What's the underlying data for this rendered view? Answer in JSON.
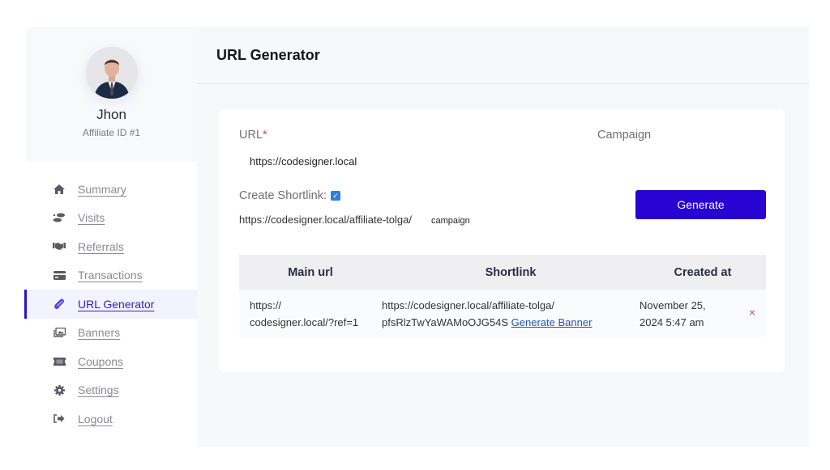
{
  "profile": {
    "name": "Jhon",
    "affiliate_id": "Affiliate ID #1",
    "avatar_icon": "user-photo"
  },
  "sidebar": {
    "items": [
      {
        "label": "Summary",
        "icon": "home-icon",
        "active": false
      },
      {
        "label": "Visits",
        "icon": "footprints-icon",
        "active": false
      },
      {
        "label": "Referrals",
        "icon": "handshake-icon",
        "active": false
      },
      {
        "label": "Transactions",
        "icon": "credit-card-icon",
        "active": false
      },
      {
        "label": "URL Generator",
        "icon": "paperclip-icon",
        "active": true
      },
      {
        "label": "Banners",
        "icon": "images-icon",
        "active": false
      },
      {
        "label": "Coupons",
        "icon": "ticket-icon",
        "active": false
      },
      {
        "label": "Settings",
        "icon": "gear-icon",
        "active": false
      },
      {
        "label": "Logout",
        "icon": "sign-out-icon",
        "active": false
      }
    ]
  },
  "header": {
    "title": "URL Generator"
  },
  "form": {
    "url_label": "URL",
    "required_mark": "*",
    "url_value": "https://codesigner.local",
    "campaign_label": "Campaign",
    "shortlink_label": "Create Shortlink:",
    "shortlink_checked": true,
    "shortlink_base": "https://codesigner.local/affiliate-tolga/",
    "shortlink_campaign": "campaign",
    "generate_label": "Generate"
  },
  "table": {
    "headers": [
      "Main url",
      "Shortlink",
      "Created at"
    ],
    "rows": [
      {
        "main_url_line1": "https://",
        "main_url_line2": "codesigner.local/?ref=1",
        "shortlink_line1": "https://codesigner.local/affiliate-tolga/",
        "shortlink_line2": "pfsRlzTwYaWAMoOJG54S",
        "banner_link": "Generate Banner",
        "created_line1": "November 25,",
        "created_line2": "2024 5:47 am",
        "delete_icon": "×"
      }
    ]
  },
  "colors": {
    "accent": "#2704d1",
    "active_nav": "#3320b8",
    "required": "#d4437a",
    "link": "#2453b8"
  }
}
